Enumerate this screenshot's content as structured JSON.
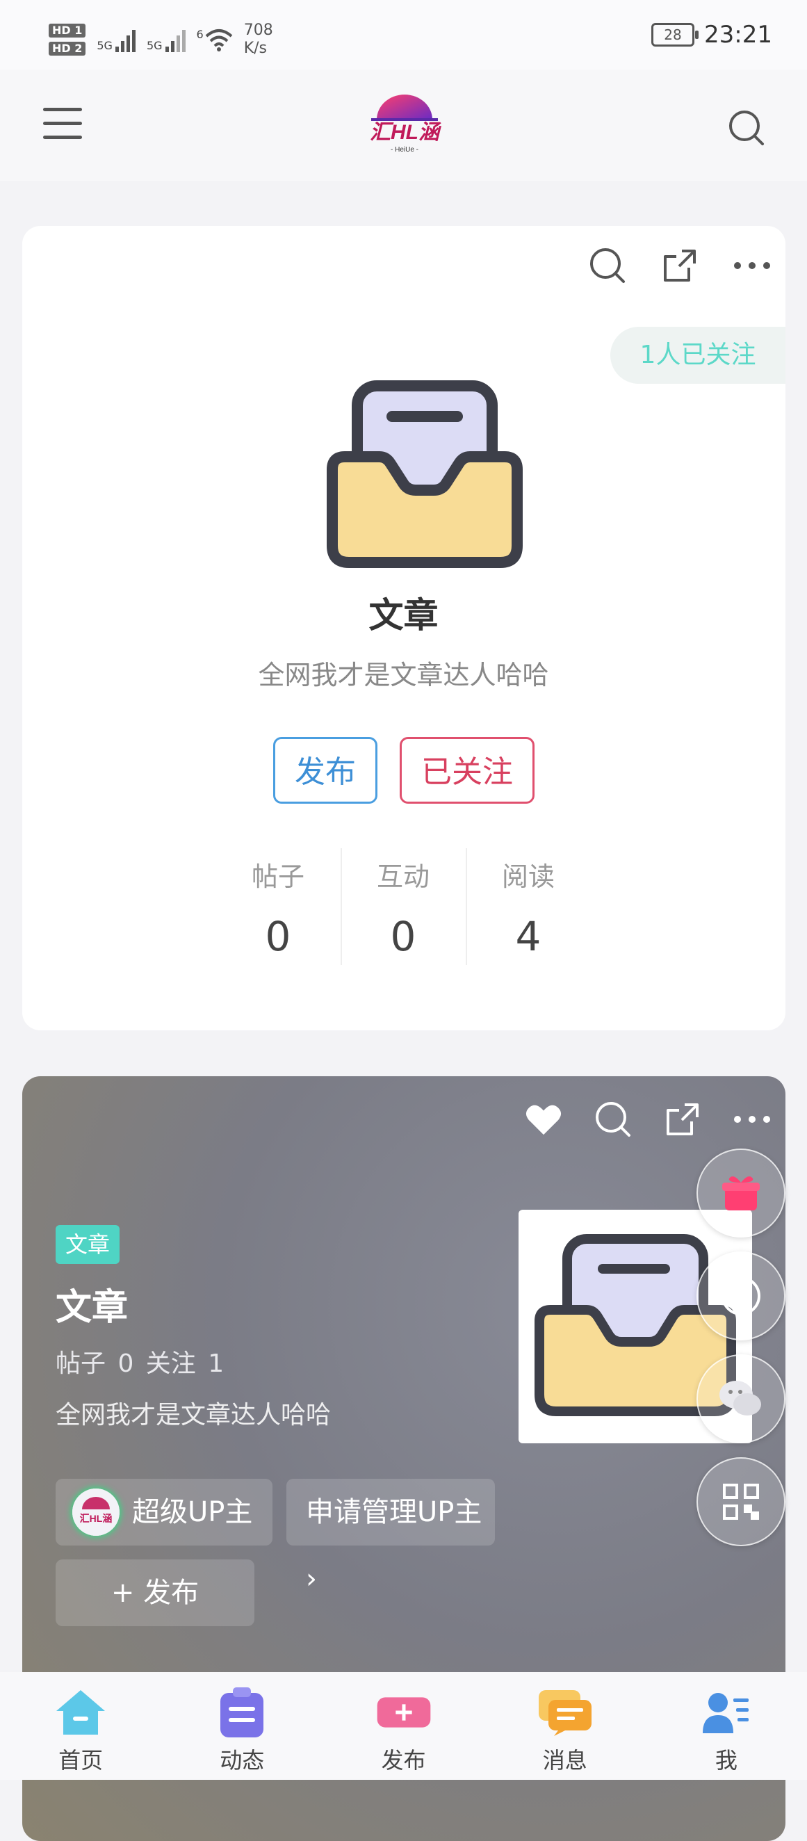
{
  "status_bar": {
    "sim1": "HD 1",
    "sim2": "HD 2",
    "net1": "5G",
    "net2": "5G",
    "net3": "6",
    "speed_value": "708",
    "speed_unit": "K/s",
    "battery": "28",
    "time": "23:21"
  },
  "header": {
    "logo_text": "汇HL涵",
    "logo_sub": "- HeiUe -"
  },
  "topic_card": {
    "title": "文章",
    "description": "全网我才是文章达人哈哈",
    "follow_badge": "1人已关注",
    "publish_button": "发布",
    "followed_button": "已关注",
    "stats": [
      {
        "label": "帖子",
        "value": "0"
      },
      {
        "label": "互动",
        "value": "0"
      },
      {
        "label": "阅读",
        "value": "4"
      }
    ]
  },
  "detail_card": {
    "tag": "文章",
    "title": "文章",
    "stats_line": "帖子 0   关注 1",
    "description": "全网我才是文章达人哈哈",
    "super_up": "超级UP主",
    "apply_manage": "申请管理UP主 ›",
    "publish": "+ 发布"
  },
  "tabbar": {
    "items": [
      {
        "label": "首页"
      },
      {
        "label": "动态"
      },
      {
        "label": "发布"
      },
      {
        "label": "消息"
      },
      {
        "label": "我"
      }
    ]
  },
  "colors": {
    "accent_teal": "#4fd4c4",
    "publish_blue": "#3d8fd6",
    "followed_red": "#d8405f"
  }
}
